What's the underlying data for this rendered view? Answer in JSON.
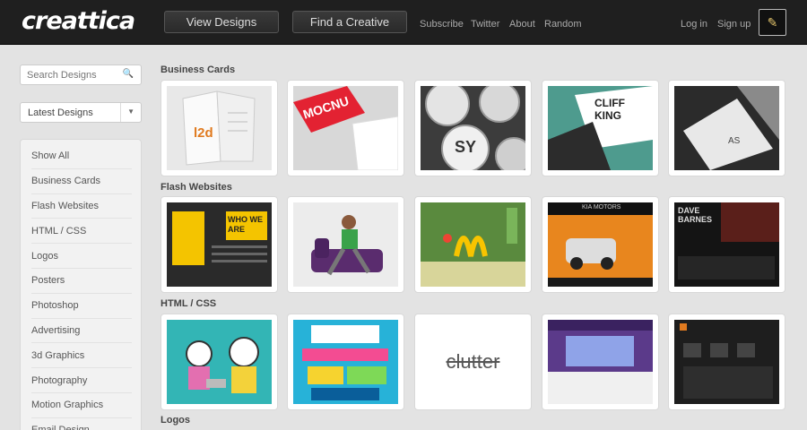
{
  "header": {
    "logo": "creattica",
    "nav": {
      "view_designs": "View Designs",
      "find_creative": "Find a Creative"
    },
    "links": [
      "Subscribe",
      "Twitter",
      "About",
      "Random"
    ],
    "auth": {
      "login": "Log in",
      "signup": "Sign up"
    }
  },
  "sidebar": {
    "search_placeholder": "Search Designs",
    "sort_selected": "Latest Designs",
    "items": [
      "Show All",
      "Business Cards",
      "Flash Websites",
      "HTML / CSS",
      "Logos",
      "Posters",
      "Photoshop",
      "Advertising",
      "3d Graphics",
      "Photography",
      "Motion Graphics",
      "Email Design"
    ]
  },
  "sections": [
    {
      "title": "Business Cards"
    },
    {
      "title": "Flash Websites"
    },
    {
      "title": "HTML / CSS"
    },
    {
      "title": "Logos"
    }
  ],
  "thumb_text": {
    "l2d": "l2d",
    "mocnu": "MOCNU",
    "cliff": "CLIFF KING",
    "who": "WHO WE ARE",
    "clutter": "clutter",
    "kia": "KIA MOTORS",
    "dave": "DAVE BARNES",
    "sy": "SY"
  },
  "colors": {
    "topbar": "#1f1f1f",
    "background": "#e3e3e3"
  }
}
